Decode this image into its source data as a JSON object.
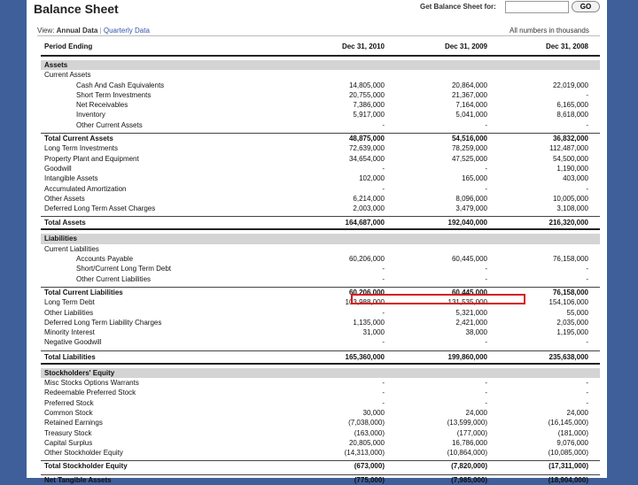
{
  "header": {
    "title": "Balance Sheet",
    "get_label": "Get Balance Sheet for:",
    "input_value": "",
    "go_label": "GO"
  },
  "view": {
    "prefix": "View:",
    "annual": "Annual Data",
    "separator": "|",
    "quarterly": "Quarterly Data",
    "units": "All numbers in thousands"
  },
  "columns": {
    "label": "Period Ending",
    "c1": "Dec 31, 2010",
    "c2": "Dec 31, 2009",
    "c3": "Dec 31, 2008"
  },
  "assets": {
    "section": "Assets",
    "current_heading": "Current Assets",
    "current_items": [
      {
        "label": "Cash And Cash Equivalents",
        "v": [
          "14,805,000",
          "20,864,000",
          "22,019,000"
        ]
      },
      {
        "label": "Short Term Investments",
        "v": [
          "20,755,000",
          "21,367,000",
          "-"
        ]
      },
      {
        "label": "Net Receivables",
        "v": [
          "7,386,000",
          "7,164,000",
          "6,165,000"
        ]
      },
      {
        "label": "Inventory",
        "v": [
          "5,917,000",
          "5,041,000",
          "8,618,000"
        ]
      },
      {
        "label": "Other Current Assets",
        "v": [
          "-",
          "-",
          "-"
        ]
      }
    ],
    "total_current": {
      "label": "Total Current Assets",
      "v": [
        "48,875,000",
        "54,516,000",
        "36,832,000"
      ]
    },
    "other_items": [
      {
        "label": "Long Term Investments",
        "v": [
          "72,639,000",
          "78,259,000",
          "112,487,000"
        ]
      },
      {
        "label": "Property Plant and Equipment",
        "v": [
          "34,654,000",
          "47,525,000",
          "54,500,000"
        ]
      },
      {
        "label": "Goodwill",
        "v": [
          "-",
          "-",
          "1,190,000"
        ]
      },
      {
        "label": "Intangible Assets",
        "v": [
          "102,000",
          "165,000",
          "403,000"
        ]
      },
      {
        "label": "Accumulated Amortization",
        "v": [
          "-",
          "-",
          "-"
        ]
      },
      {
        "label": "Other Assets",
        "v": [
          "6,214,000",
          "8,096,000",
          "10,005,000"
        ]
      },
      {
        "label": "Deferred Long Term Asset Charges",
        "v": [
          "2,003,000",
          "3,479,000",
          "3,108,000"
        ]
      }
    ],
    "total": {
      "label": "Total Assets",
      "v": [
        "164,687,000",
        "192,040,000",
        "216,320,000"
      ]
    }
  },
  "liabilities": {
    "section": "Liabilities",
    "current_heading": "Current Liabilities",
    "current_items": [
      {
        "label": "Accounts Payable",
        "v": [
          "60,206,000",
          "60,445,000",
          "76,158,000"
        ]
      },
      {
        "label": "Short/Current Long Term Debt",
        "v": [
          "-",
          "-",
          "-"
        ]
      },
      {
        "label": "Other Current Liabilities",
        "v": [
          "-",
          "-",
          "-"
        ]
      }
    ],
    "total_current": {
      "label": "Total Current Liabilities",
      "v": [
        "60,206,000",
        "60,445,000",
        "76,158,000"
      ]
    },
    "other_items": [
      {
        "label": "Long Term Debt",
        "v": [
          "103,988,000",
          "131,535,000",
          "154,106,000"
        ]
      },
      {
        "label": "Other Liabilities",
        "v": [
          "-",
          "5,321,000",
          "55,000"
        ]
      },
      {
        "label": "Deferred Long Term Liability Charges",
        "v": [
          "1,135,000",
          "2,421,000",
          "2,035,000"
        ]
      },
      {
        "label": "Minority Interest",
        "v": [
          "31,000",
          "38,000",
          "1,195,000"
        ]
      },
      {
        "label": "Negative Goodwill",
        "v": [
          "-",
          "-",
          "-"
        ]
      }
    ],
    "total": {
      "label": "Total Liabilities",
      "v": [
        "165,360,000",
        "199,860,000",
        "235,638,000"
      ]
    }
  },
  "equity": {
    "section": "Stockholders' Equity",
    "items": [
      {
        "label": "Misc Stocks Options Warrants",
        "v": [
          "-",
          "-",
          "-"
        ]
      },
      {
        "label": "Redeemable Preferred Stock",
        "v": [
          "-",
          "-",
          "-"
        ]
      },
      {
        "label": "Preferred Stock",
        "v": [
          "-",
          "-",
          "-"
        ]
      },
      {
        "label": "Common Stock",
        "v": [
          "30,000",
          "24,000",
          "24,000"
        ]
      },
      {
        "label": "Retained Earnings",
        "v": [
          "(7,038,000)",
          "(13,599,000)",
          "(16,145,000)"
        ]
      },
      {
        "label": "Treasury Stock",
        "v": [
          "(163,000)",
          "(177,000)",
          "(181,000)"
        ]
      },
      {
        "label": "Capital Surplus",
        "v": [
          "20,805,000",
          "16,786,000",
          "9,076,000"
        ]
      },
      {
        "label": "Other Stockholder Equity",
        "v": [
          "(14,313,000)",
          "(10,864,000)",
          "(10,085,000)"
        ]
      }
    ],
    "total": {
      "label": "Total Stockholder Equity",
      "v": [
        "(673,000)",
        "(7,820,000)",
        "(17,311,000)"
      ]
    },
    "net_tangible": {
      "label": "Net Tangible Assets",
      "v": [
        "(775,000)",
        "(7,985,000)",
        "(18,904,000)"
      ]
    }
  },
  "colors": {
    "background": "#3f5f9a",
    "section_fill": "#d4d4d4",
    "highlight": "#d81818",
    "link": "#3355aa"
  }
}
